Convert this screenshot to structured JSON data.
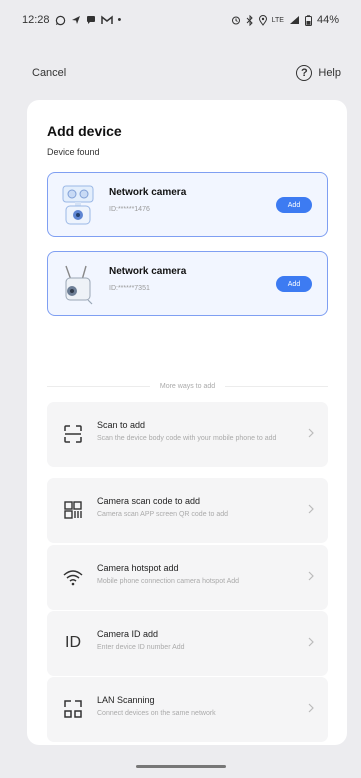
{
  "status_bar": {
    "time": "12:28",
    "network": "LTE",
    "battery": "44%"
  },
  "header": {
    "cancel_label": "Cancel",
    "help_label": "Help",
    "help_icon_glyph": "?"
  },
  "main": {
    "title": "Add device",
    "subtitle": "Device found",
    "devices": [
      {
        "name": "Network camera",
        "id": "ID:******1476",
        "add_label": "Add"
      },
      {
        "name": "Network camera",
        "id": "ID:******7351",
        "add_label": "Add"
      }
    ],
    "more_ways_label": "More ways to add",
    "options": [
      {
        "icon": "scan-icon",
        "title": "Scan to add",
        "description": "Scan the device body code with your mobile phone to add"
      },
      {
        "icon": "qr-code-icon",
        "title": "Camera scan code to add",
        "description": "Camera scan APP screen QR code to add"
      },
      {
        "icon": "wifi-icon",
        "title": "Camera hotspot add",
        "description": "Mobile phone connection camera hotspot Add"
      },
      {
        "icon": "id-icon",
        "title": "Camera ID add",
        "description": "Enter device ID number Add",
        "icon_text": "ID"
      },
      {
        "icon": "lan-scan-icon",
        "title": "LAN Scanning",
        "description": "Connect devices on the same network"
      }
    ]
  },
  "colors": {
    "accent": "#3d7bf2",
    "device_border": "#7f9ff2",
    "device_bg": "#f2f6ff",
    "option_bg": "#f5f5f6"
  }
}
